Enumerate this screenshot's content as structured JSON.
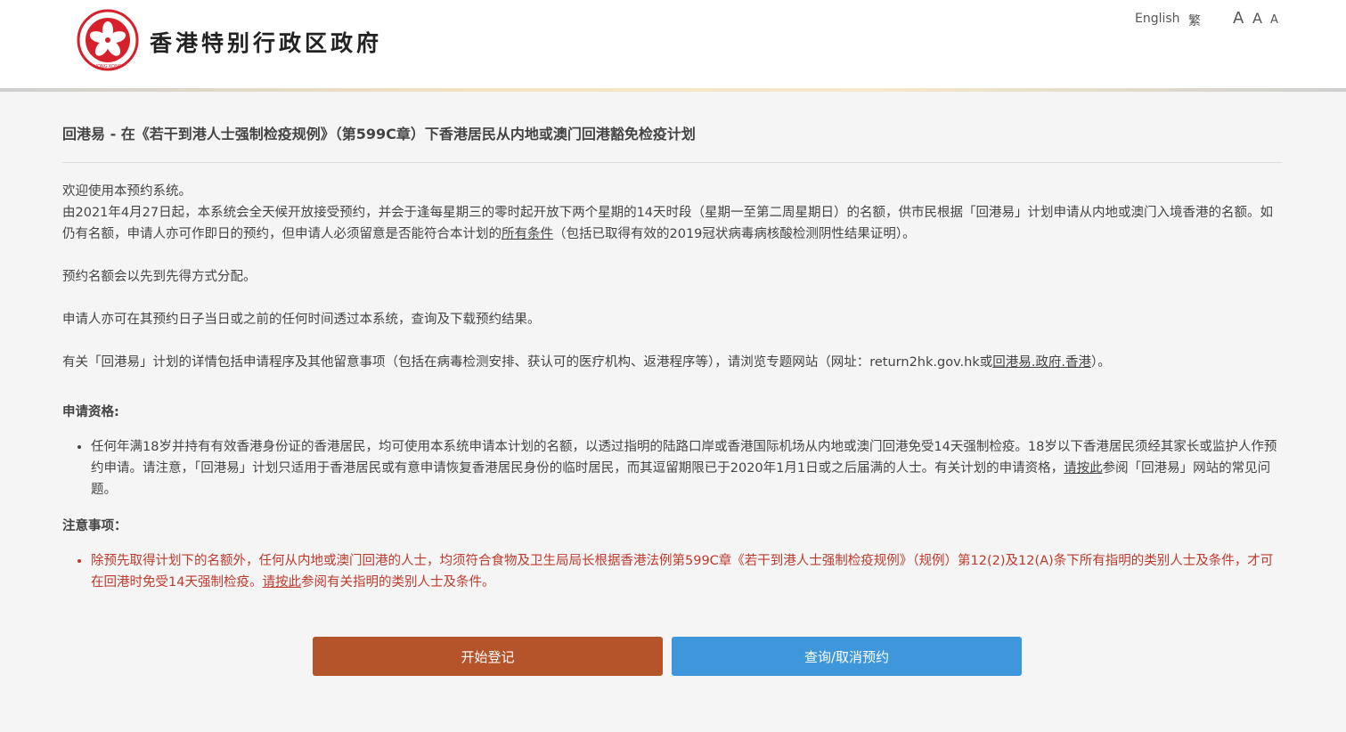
{
  "header": {
    "gov_name": "香港特别行政区政府",
    "emblem_text": "HONG KONG",
    "lang_english": "English",
    "lang_traditional": "繁",
    "font_large": "A",
    "font_medium": "A",
    "font_small": "A"
  },
  "main": {
    "title": "回港易 - 在《若干到港人士强制检疫规例》（第599C章）下香港居民从内地或澳门回港豁免检疫计划",
    "welcome": "欢迎使用本预约系统。",
    "intro_part1": "由2021年4月27日起，本系统会全天候开放接受预约，并会于逢每星期三的零时起开放下两个星期的14天时段（星期一至第二周星期日）的名额，供市民根据「回港易」计划申请从内地或澳门入境香港的名额。如仍有名额，申请人亦可作即日的预约，但申请人必须留意是否能符合本计划的",
    "intro_link": "所有条件",
    "intro_part2": "（包括已取得有效的2019冠状病毒病核酸检测阴性结果证明）。",
    "quota": "预约名额会以先到先得方式分配。",
    "query": "申请人亦可在其预约日子当日或之前的任何时间透过本系统，查询及下载预约结果。",
    "details_part1": "有关「回港易」计划的详情包括申请程序及其他留意事项（包括在病毒检测安排、获认可的医疗机构、返港程序等），请浏览专题网站（网址：return2hk.gov.hk或",
    "details_link": "回港易.政府.香港",
    "details_part2": "）。",
    "eligibility_heading": "申请资格:",
    "eligibility_part1": "任何年满18岁并持有有效香港身份证的香港居民，均可使用本系统申请本计划的名额，以透过指明的陆路口岸或香港国际机场从内地或澳门回港免受14天强制检疫。18岁以下香港居民须经其家长或监护人作预约申请。请注意，「回港易」计划只适用于香港居民或有意申请恢复香港居民身份的临时居民，而其逗留期限已于2020年1月1日或之后届满的人士。有关计划的申请资格，",
    "eligibility_link": "请按此",
    "eligibility_part2": "参阅「回港易」网站的常见问题。",
    "notes_heading": "注意事项：",
    "notes_part1": "除预先取得计划下的名额外，任何从内地或澳门回港的人士，均须符合食物及卫生局局长根据香港法例第599C章《若干到港人士强制检疫规例》（规例）第12(2)及12(A)条下所有指明的类别人士及条件，才可在回港时免受14天强制检疫。",
    "notes_link": "请按此",
    "notes_part2": "参阅有关指明的类别人士及条件。"
  },
  "buttons": {
    "start_label": "开始登记",
    "query_label": "查询/取消预约"
  },
  "colors": {
    "start_button": "#b5532a",
    "query_button": "#3d97da",
    "notes_text": "#c0392b"
  }
}
